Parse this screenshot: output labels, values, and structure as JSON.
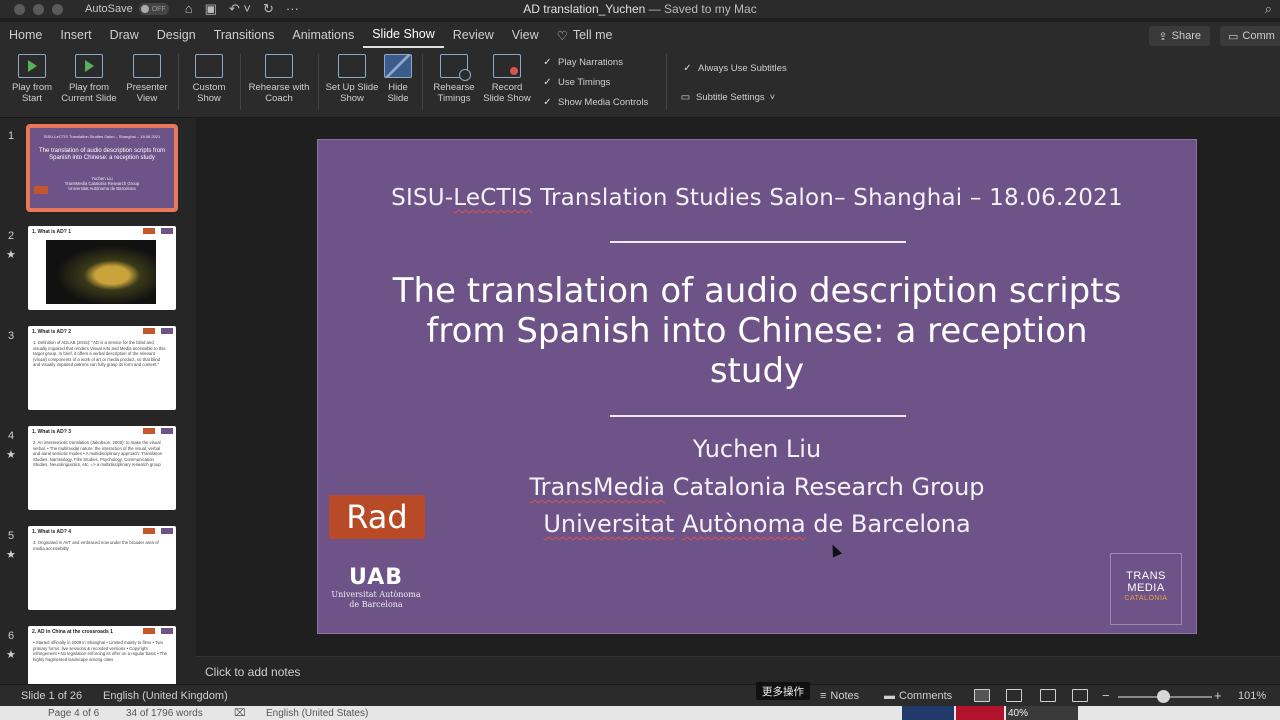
{
  "titlebar": {
    "autosave_label": "AutoSave",
    "autosave_state": "OFF",
    "doc_name": "AD translation_Yuchen",
    "doc_status": "— Saved to my Mac"
  },
  "tabs": [
    "Home",
    "Insert",
    "Draw",
    "Design",
    "Transitions",
    "Animations",
    "Slide Show",
    "Review",
    "View"
  ],
  "tell_me": "Tell me",
  "share_label": "Share",
  "comments_label": "Comm",
  "ribbon": {
    "play_from_start": "Play from Start",
    "play_from_current": "Play from Current Slide",
    "presenter_view": "Presenter View",
    "custom_show": "Custom Show",
    "rehearse_coach": "Rehearse with Coach",
    "setup_show": "Set Up Slide Show",
    "hide_slide": "Hide Slide",
    "rehearse_timings": "Rehearse Timings",
    "record_show": "Record Slide Show",
    "play_narrations": "Play Narrations",
    "use_timings": "Use Timings",
    "show_media_controls": "Show Media Controls",
    "always_subtitles": "Always Use Subtitles",
    "subtitle_settings": "Subtitle Settings"
  },
  "thumbnails": [
    {
      "num": "1",
      "starred": false,
      "head": "SISU-LeCTIS Translation Studies Salon – Shanghai – 18.06.2021",
      "title": "The translation of audio description scripts from Spanish into Chinese: a reception study",
      "sub": "Yuchen Liu\nTransMedia Catalonia Research Group\nUniversitat Autònoma de Barcelona"
    },
    {
      "num": "2",
      "starred": true,
      "title": "1. What is AD? 1",
      "text": ""
    },
    {
      "num": "3",
      "starred": false,
      "title": "1. What is AD? 2",
      "text": "1. Definition of ADLAB (2015): \"AD is a service for the blind and visually impaired that renders Visual Arts and Media accessible to this target group. In brief, it offers a verbal description of the relevant (visual) components of a work of art or media product, so that blind and visually impaired patrons can fully grasp its form and content.\""
    },
    {
      "num": "4",
      "starred": true,
      "title": "1. What is AD? 3",
      "text": "2. An intersemiotic translation (Jakobson, 2000): to make the visual verbal. • The multimodal nature: the interaction of the visual, verbal and aural semiotic modes • A multidisciplinary approach: Translation Studies, Narratology, Film Studies, Psychology, Communication Studies, Neurolinguistics, etc. => a multidisciplinary research group"
    },
    {
      "num": "5",
      "starred": true,
      "title": "1. What is AD? 4",
      "text": "3. Originated in AVT and embraced now under the broader area of media accessibility"
    },
    {
      "num": "6",
      "starred": true,
      "title": "2. AD in China at the crossroads 1",
      "text": "• Started officially in 2009 in Shanghai • Limited mainly to films • Two primary forms: live sessions & recorded versions • Copyright infringement • No legislation enforcing its offer on a regular basis • The highly fragmented landscape among cities"
    }
  ],
  "slide": {
    "header": "SISU-LeCTIS Translation Studies Salon– Shanghai – 18.06.2021",
    "title": "The translation of audio description scripts from Spanish into Chinese: a reception study",
    "author": "Yuchen Liu",
    "group": "TransMedia Catalonia Research Group",
    "university": "Universitat Autònoma de Barcelona",
    "logo_rad": "Rad",
    "logo_uab": "UAB",
    "logo_uab_sub": "Universitat Autònoma de Barcelona",
    "logo_tm_1": "TRANS",
    "logo_tm_2": "MEDIA",
    "logo_tm_3": "CATALONIA"
  },
  "notes_placeholder": "Click to add notes",
  "status": {
    "slide_of": "Slide 1 of 26",
    "language": "English (United Kingdom)",
    "tooltip": "更多操作",
    "notes": "Notes",
    "comments": "Comments",
    "zoom": "101%"
  },
  "behind_window": {
    "page": "Page 4 of 6",
    "words": "34 of 1796 words",
    "language": "English (United States)",
    "percent": "40%"
  }
}
